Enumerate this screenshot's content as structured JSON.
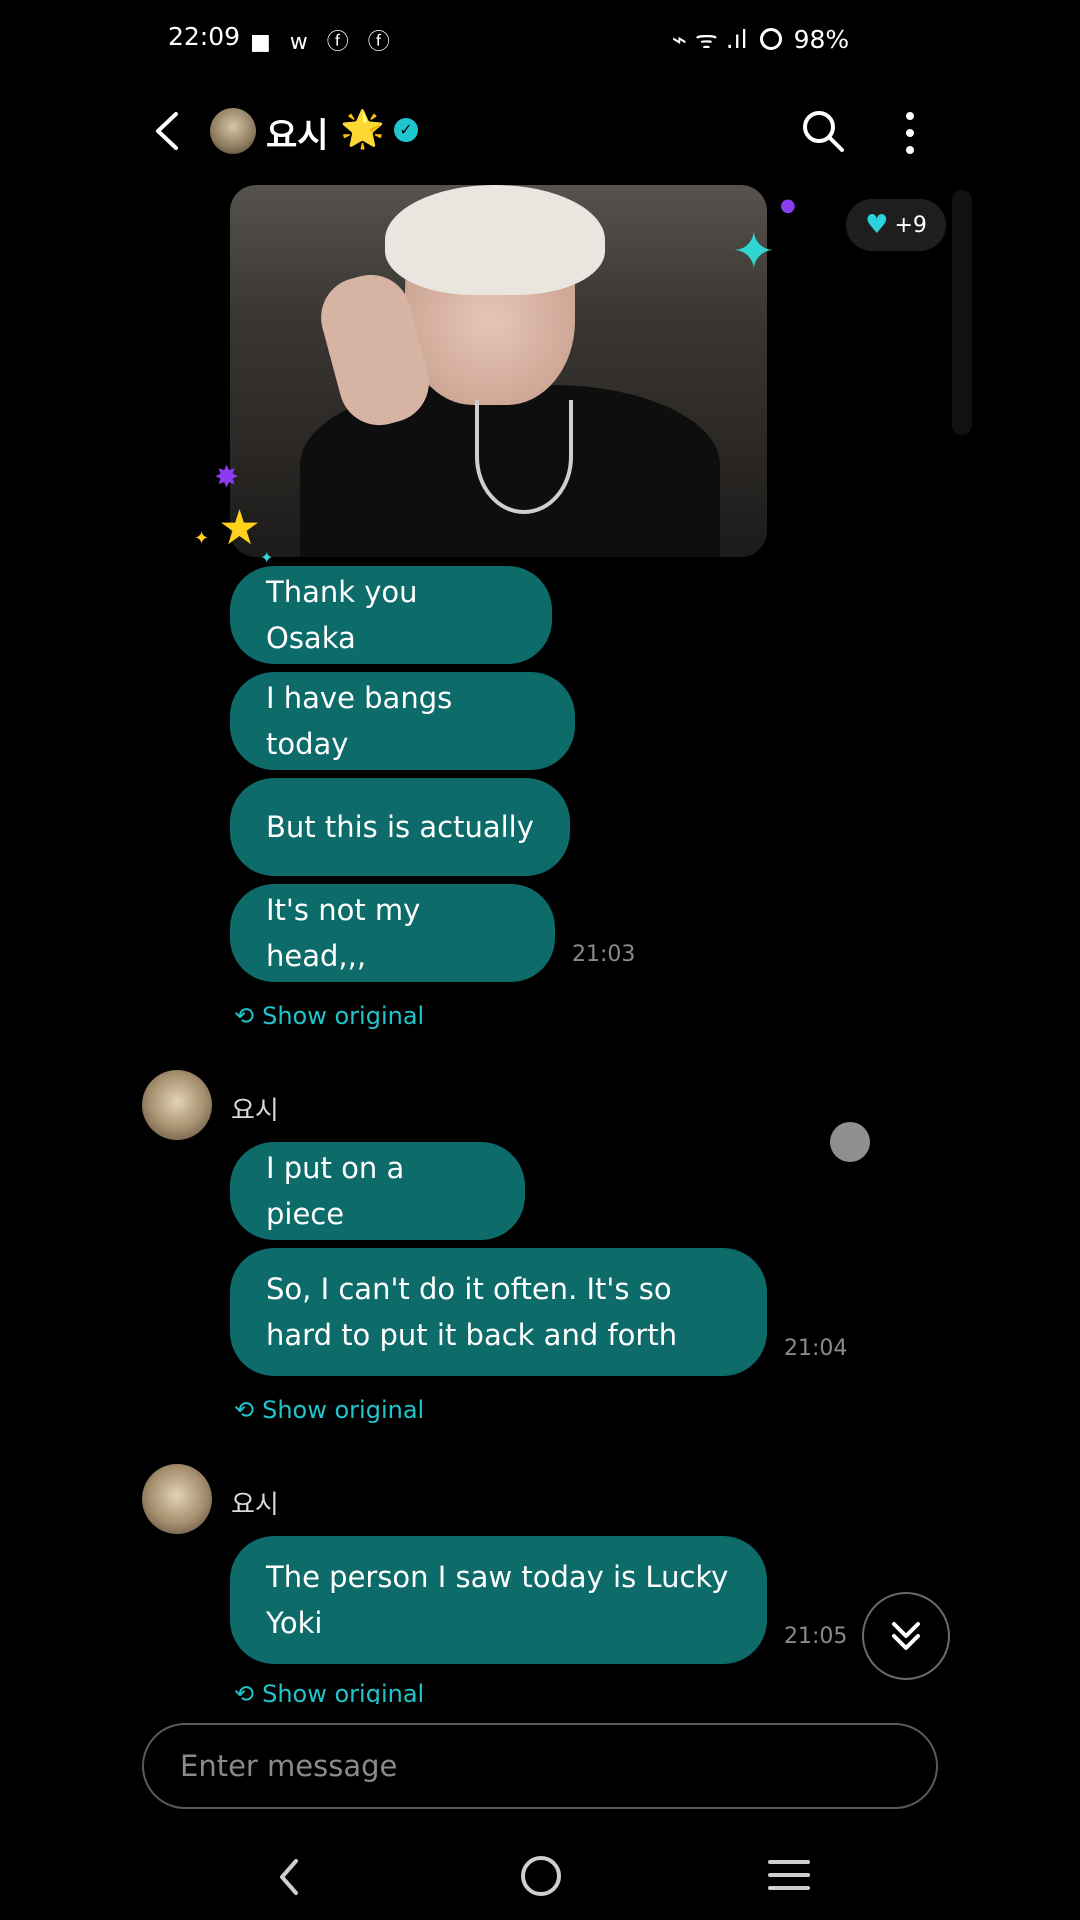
{
  "status_bar": {
    "time": "22:09",
    "left_icons": "■ w ⓕ ⓕ",
    "right_icons": "⌁ ᯤ .ıl",
    "battery": "98%"
  },
  "header": {
    "name": "요시",
    "star": "🌟",
    "verified": "✓"
  },
  "reaction": {
    "heart": "♥",
    "count": "+9"
  },
  "messages": {
    "group1": {
      "bubbles": [
        "Thank you Osaka",
        "I have bangs today",
        "But this is actually",
        "It's not my head,,,"
      ],
      "time": "21:03",
      "show_original": "Show original"
    },
    "group2": {
      "sender": "요시",
      "bubbles": [
        "I put on a piece",
        "So, I can't do it often. It's so hard to put it back and forth"
      ],
      "time": "21:04",
      "show_original": "Show original"
    },
    "group3": {
      "sender": "요시",
      "bubbles": [
        "The person I saw today is Lucky Yoki"
      ],
      "time": "21:05",
      "show_original": "Show original"
    }
  },
  "input": {
    "placeholder": "Enter message"
  },
  "colors": {
    "bubble": "#0d6b69",
    "accent": "#22c4cc",
    "background": "#000000"
  }
}
